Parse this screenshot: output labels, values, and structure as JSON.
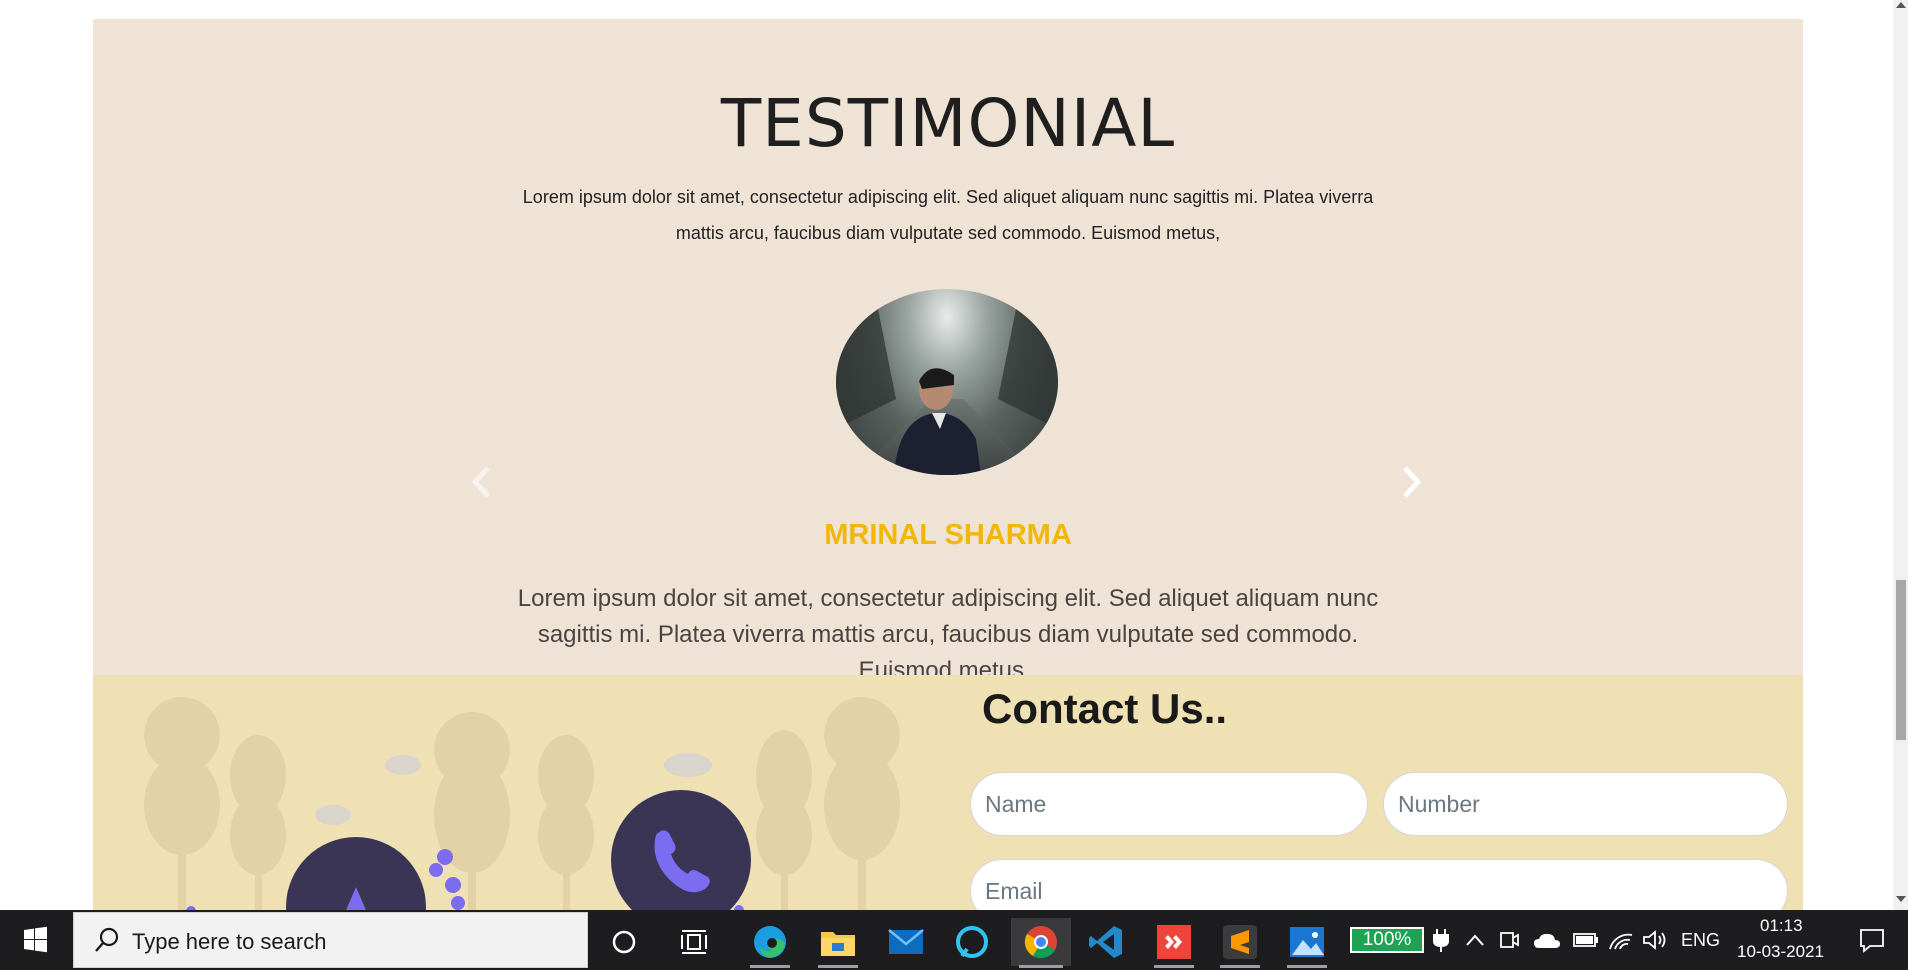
{
  "testimonial": {
    "title": "TESTIMONIAL",
    "intro": "Lorem ipsum dolor sit amet, consectetur adipiscing elit. Sed aliquet aliquam nunc sagittis mi. Platea viverra mattis arcu, faucibus diam vulputate sed commodo. Euismod metus,",
    "prev_icon": "chevron-left-icon",
    "next_icon": "chevron-right-icon",
    "name": "MRINAL SHARMA",
    "quote": "Lorem ipsum dolor sit amet, consectetur adipiscing elit. Sed aliquet aliquam nunc sagittis mi. Platea viverra mattis arcu, faucibus diam vulputate sed commodo. Euismod metus..",
    "name_color": "#f2b705",
    "background": "#efe3d6"
  },
  "contact": {
    "title": "Contact Us..",
    "name_placeholder": "Name",
    "number_placeholder": "Number",
    "email_placeholder": "Email",
    "background": "#efe1b3",
    "illustration_icons": [
      "phone-icon",
      "navigation-icon"
    ]
  },
  "taskbar": {
    "search_placeholder": "Type here to search",
    "apps": [
      "start-icon",
      "cortana-icon",
      "task-view-icon",
      "edge-icon",
      "file-explorer-icon",
      "mail-icon",
      "alexa-icon",
      "chrome-icon",
      "vscode-icon",
      "anydesk-icon",
      "sublime-icon",
      "photos-icon"
    ],
    "battery": "100%",
    "language": "ENG",
    "time": "01:13",
    "date": "10-03-2021"
  }
}
